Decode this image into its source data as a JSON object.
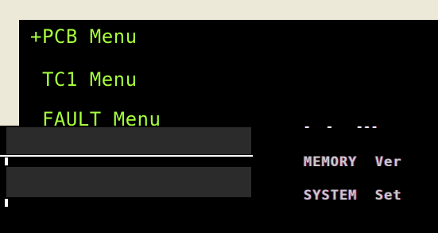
{
  "menu": {
    "items": [
      {
        "label": "+PCB Menu"
      },
      {
        "label": " TC1 Menu"
      },
      {
        "label": " FAULT Menu"
      }
    ]
  },
  "overlay": {
    "right_lines": [
      {
        "text": "-  -   ---"
      },
      {
        "text": "MEMORY  Ver"
      },
      {
        "text": "SYSTEM  Set"
      }
    ]
  },
  "colors": {
    "background": "#ece9d8",
    "panel": "#000000",
    "text": "#a6ff3c"
  }
}
